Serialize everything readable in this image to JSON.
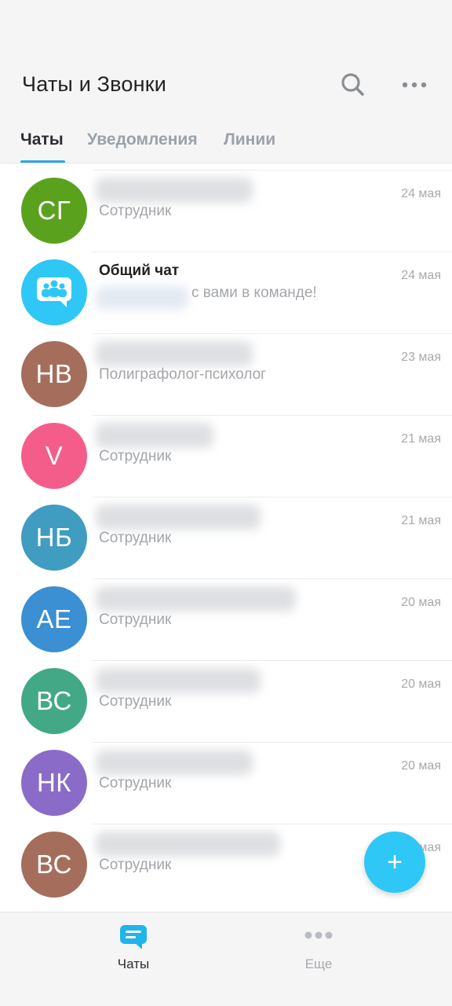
{
  "header": {
    "title": "Чаты и Звонки",
    "tabs": [
      {
        "label": "Чаты",
        "active": true
      },
      {
        "label": "Уведомления",
        "active": false
      },
      {
        "label": "Линии",
        "active": false
      }
    ]
  },
  "chats": [
    {
      "initials": "СГ",
      "avatar_color": "#5aa21e",
      "name": "",
      "subtitle": "Сотрудник",
      "date": "24 мая"
    },
    {
      "initials": "",
      "avatar_color": "#2fc7f5",
      "name": "Общий чат",
      "subtitle": "с вами в команде!",
      "date": "24 мая",
      "group_icon": "group-chat-icon"
    },
    {
      "initials": "НВ",
      "avatar_color": "#a56e5c",
      "name": "",
      "subtitle": "Полиграфолог-психолог",
      "date": "23 мая"
    },
    {
      "initials": "V",
      "avatar_color": "#f45d8a",
      "name": "",
      "subtitle": "Сотрудник",
      "date": "21 мая"
    },
    {
      "initials": "НБ",
      "avatar_color": "#409cc0",
      "name": "",
      "subtitle": "Сотрудник",
      "date": "21 мая"
    },
    {
      "initials": "АЕ",
      "avatar_color": "#3b8fd3",
      "name": "",
      "subtitle": "Сотрудник",
      "date": "20 мая"
    },
    {
      "initials": "ВС",
      "avatar_color": "#43a886",
      "name": "",
      "subtitle": "Сотрудник",
      "date": "20 мая"
    },
    {
      "initials": "НК",
      "avatar_color": "#8b6bc8",
      "name": "",
      "subtitle": "Сотрудник",
      "date": "20 мая"
    },
    {
      "initials": "ВС",
      "avatar_color": "#a56e5c",
      "name": "",
      "subtitle": "Сотрудник",
      "date": "20 мая"
    }
  ],
  "fab": {
    "label": "+"
  },
  "bottom_nav": [
    {
      "label": "Чаты",
      "icon": "chat-bubble-icon",
      "active": true
    },
    {
      "label": "Еще",
      "icon": "more-dots-icon",
      "active": false
    }
  ],
  "colors": {
    "accent": "#2fa6e6",
    "fab": "#2fc7f5",
    "nav_active": "#1fb4ec",
    "nav_inactive": "#b9bdc2"
  }
}
